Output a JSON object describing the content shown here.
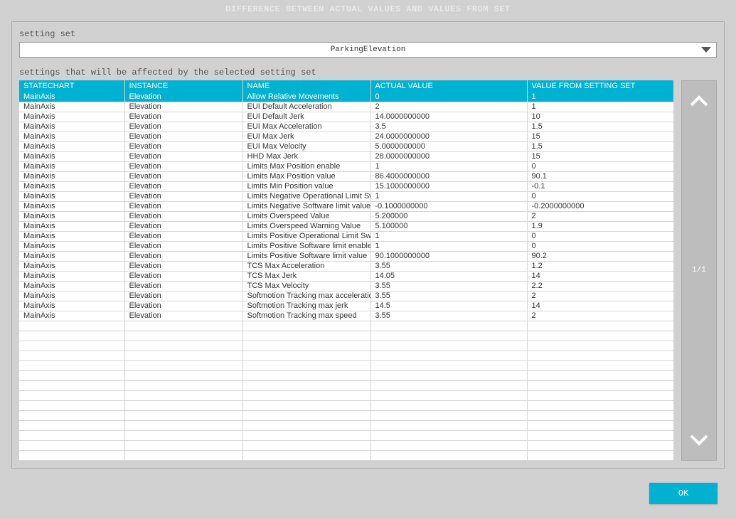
{
  "title": "DIFFERENCE BETWEEN ACTUAL VALUES AND VALUES FROM SET",
  "setting_set_label": "setting set",
  "setting_set_value": "ParkingElevation",
  "section_label": "settings that will be affected by the selected setting set",
  "columns": {
    "statechart": "STATECHART",
    "instance": "INSTANCE",
    "name": "NAME",
    "actual": "ACTUAL VALUE",
    "set": "VALUE FROM SETTING SET"
  },
  "rows": [
    {
      "statechart": "MainAxis",
      "instance": "Elevation",
      "name": "Allow Relative Movements",
      "actual": "0",
      "set": "1",
      "selected": true
    },
    {
      "statechart": "MainAxis",
      "instance": "Elevation",
      "name": "EUI Default Acceleration",
      "actual": "2",
      "set": "1"
    },
    {
      "statechart": "MainAxis",
      "instance": "Elevation",
      "name": "EUI Default Jerk",
      "actual": "14.0000000000",
      "set": "10"
    },
    {
      "statechart": "MainAxis",
      "instance": "Elevation",
      "name": "EUI Max Acceleration",
      "actual": "3.5",
      "set": "1.5"
    },
    {
      "statechart": "MainAxis",
      "instance": "Elevation",
      "name": "EUI Max Jerk",
      "actual": "24.0000000000",
      "set": "15"
    },
    {
      "statechart": "MainAxis",
      "instance": "Elevation",
      "name": "EUI Max Velocity",
      "actual": "5.0000000000",
      "set": "1.5"
    },
    {
      "statechart": "MainAxis",
      "instance": "Elevation",
      "name": "HHD Max Jerk",
      "actual": "28.0000000000",
      "set": "15"
    },
    {
      "statechart": "MainAxis",
      "instance": "Elevation",
      "name": "Limits Max Position enable",
      "actual": "1",
      "set": "0"
    },
    {
      "statechart": "MainAxis",
      "instance": "Elevation",
      "name": "Limits Max Position value",
      "actual": "86.4000000000",
      "set": "90.1"
    },
    {
      "statechart": "MainAxis",
      "instance": "Elevation",
      "name": "Limits Min Position value",
      "actual": "15.1000000000",
      "set": "-0.1"
    },
    {
      "statechart": "MainAxis",
      "instance": "Elevation",
      "name": "Limits Negative Operational Limit Switch",
      "actual": "1",
      "set": "0"
    },
    {
      "statechart": "MainAxis",
      "instance": "Elevation",
      "name": "Limits Negative Software limit value",
      "actual": "-0.1000000000",
      "set": "-0.2000000000"
    },
    {
      "statechart": "MainAxis",
      "instance": "Elevation",
      "name": "Limits Overspeed Value",
      "actual": "5.200000",
      "set": "2"
    },
    {
      "statechart": "MainAxis",
      "instance": "Elevation",
      "name": "Limits Overspeed Warning Value",
      "actual": "5.100000",
      "set": "1.9"
    },
    {
      "statechart": "MainAxis",
      "instance": "Elevation",
      "name": "Limits Positive Operational Limit Switch",
      "actual": "1",
      "set": "0"
    },
    {
      "statechart": "MainAxis",
      "instance": "Elevation",
      "name": "Limits Positive Software limit enable",
      "actual": "1",
      "set": "0"
    },
    {
      "statechart": "MainAxis",
      "instance": "Elevation",
      "name": "Limits Positive Software limit value",
      "actual": "90.1000000000",
      "set": "90.2"
    },
    {
      "statechart": "MainAxis",
      "instance": "Elevation",
      "name": "TCS Max Acceleration",
      "actual": "3.55",
      "set": "1.2"
    },
    {
      "statechart": "MainAxis",
      "instance": "Elevation",
      "name": "TCS Max Jerk",
      "actual": "14.05",
      "set": "14"
    },
    {
      "statechart": "MainAxis",
      "instance": "Elevation",
      "name": "TCS Max Velocity",
      "actual": "3.55",
      "set": "2.2"
    },
    {
      "statechart": "MainAxis",
      "instance": "Elevation",
      "name": "Softmotion Tracking max acceleration",
      "actual": "3.55",
      "set": "2"
    },
    {
      "statechart": "MainAxis",
      "instance": "Elevation",
      "name": "Softmotion Tracking max jerk",
      "actual": "14.5",
      "set": "14"
    },
    {
      "statechart": "MainAxis",
      "instance": "Elevation",
      "name": "Softmotion Tracking max speed",
      "actual": "3.55",
      "set": "2"
    }
  ],
  "empty_rows": 14,
  "page_indicator": "1/1",
  "ok_label": "OK"
}
